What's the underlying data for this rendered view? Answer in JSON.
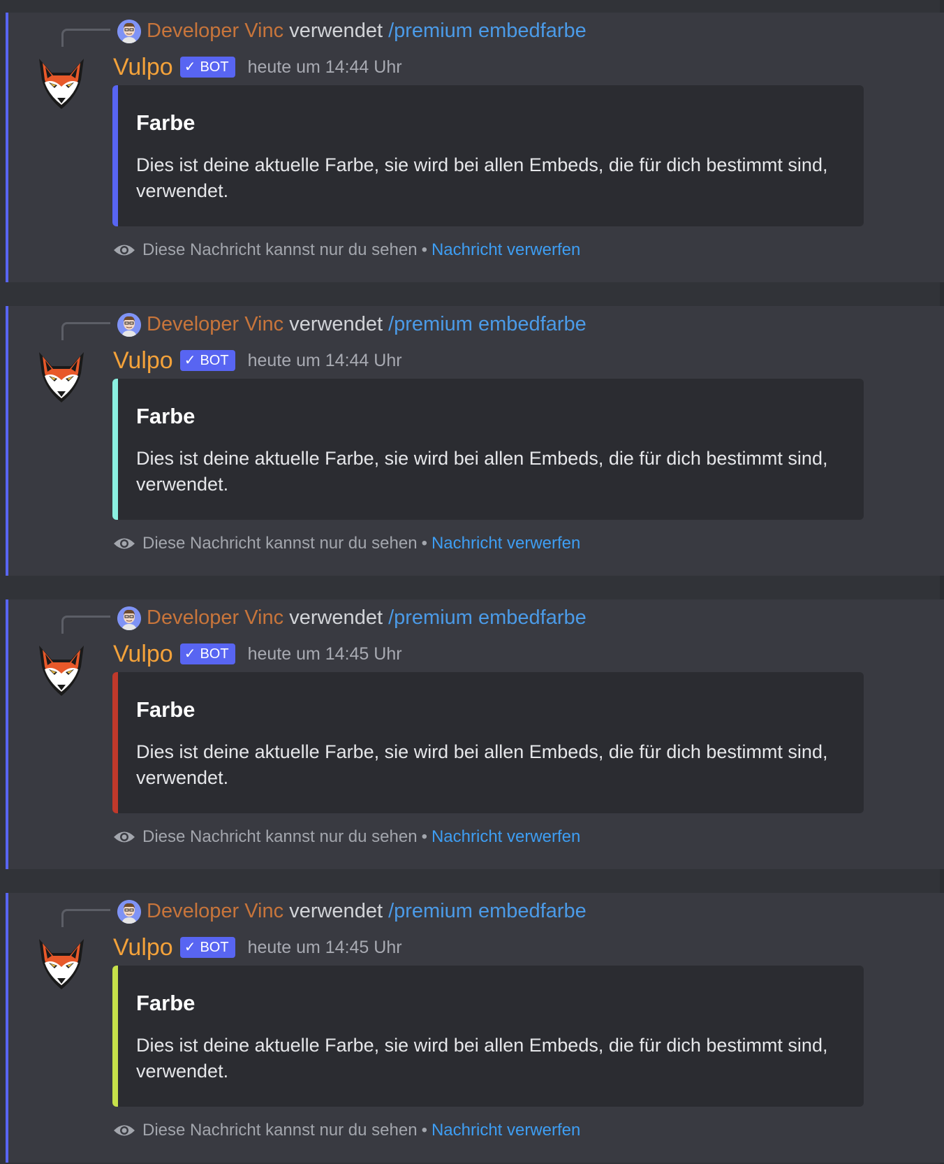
{
  "messages": [
    {
      "reply": {
        "user": "Developer Vinc",
        "verb": "verwendet",
        "command": "/premium embedfarbe"
      },
      "author": "Vulpo",
      "badge": "BOT",
      "timestamp": "heute um 14:44 Uhr",
      "embed": {
        "title": "Farbe",
        "description": "Dies ist deine aktuelle Farbe, sie wird bei allen Embeds, die für dich bestimmt sind, verwendet.",
        "color": "#5865f2"
      },
      "ephemeral": {
        "text": "Diese Nachricht kannst nur du sehen",
        "separator": "•",
        "dismiss": "Nachricht verwerfen"
      }
    },
    {
      "reply": {
        "user": "Developer Vinc",
        "verb": "verwendet",
        "command": "/premium embedfarbe"
      },
      "author": "Vulpo",
      "badge": "BOT",
      "timestamp": "heute um 14:44 Uhr",
      "embed": {
        "title": "Farbe",
        "description": "Dies ist deine aktuelle Farbe, sie wird bei allen Embeds, die für dich bestimmt sind, verwendet.",
        "color": "#8af0e0"
      },
      "ephemeral": {
        "text": "Diese Nachricht kannst nur du sehen",
        "separator": "•",
        "dismiss": "Nachricht verwerfen"
      }
    },
    {
      "reply": {
        "user": "Developer Vinc",
        "verb": "verwendet",
        "command": "/premium embedfarbe"
      },
      "author": "Vulpo",
      "badge": "BOT",
      "timestamp": "heute um 14:45 Uhr",
      "embed": {
        "title": "Farbe",
        "description": "Dies ist deine aktuelle Farbe, sie wird bei allen Embeds, die für dich bestimmt sind, verwendet.",
        "color": "#c0392b"
      },
      "ephemeral": {
        "text": "Diese Nachricht kannst nur du sehen",
        "separator": "•",
        "dismiss": "Nachricht verwerfen"
      }
    },
    {
      "reply": {
        "user": "Developer Vinc",
        "verb": "verwendet",
        "command": "/premium embedfarbe"
      },
      "author": "Vulpo",
      "badge": "BOT",
      "timestamp": "heute um 14:45 Uhr",
      "embed": {
        "title": "Farbe",
        "description": "Dies ist deine aktuelle Farbe, sie wird bei allen Embeds, die für dich bestimmt sind, verwendet.",
        "color": "#c6e04a"
      },
      "ephemeral": {
        "text": "Diese Nachricht kannst nur du sehen",
        "separator": "•",
        "dismiss": "Nachricht verwerfen"
      }
    }
  ],
  "icons": {
    "reply_avatar": "developer-avatar-icon",
    "bot_avatar": "fox-avatar-icon",
    "badge_check": "checkmark-icon",
    "ephemeral": "eye-icon"
  },
  "colors": {
    "background": "#313338",
    "message_highlight": "#393a41",
    "accent": "#5865f2",
    "link": "#3e9ef3"
  }
}
